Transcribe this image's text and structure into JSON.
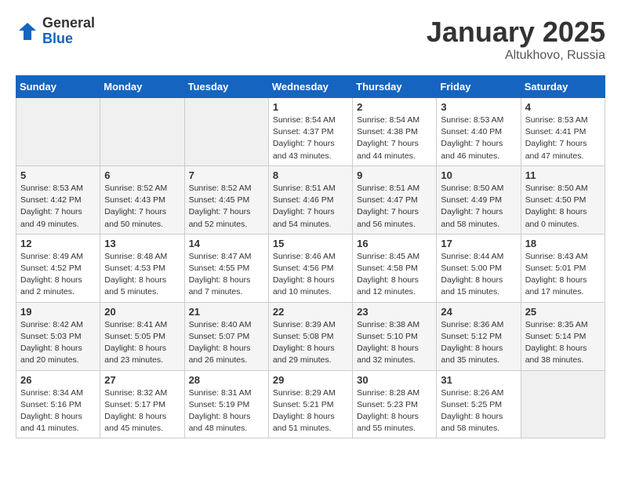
{
  "logo": {
    "general": "General",
    "blue": "Blue"
  },
  "title": "January 2025",
  "location": "Altukhovo, Russia",
  "days_header": [
    "Sunday",
    "Monday",
    "Tuesday",
    "Wednesday",
    "Thursday",
    "Friday",
    "Saturday"
  ],
  "weeks": [
    [
      {
        "day": "",
        "sunrise": "",
        "sunset": "",
        "daylight": ""
      },
      {
        "day": "",
        "sunrise": "",
        "sunset": "",
        "daylight": ""
      },
      {
        "day": "",
        "sunrise": "",
        "sunset": "",
        "daylight": ""
      },
      {
        "day": "1",
        "sunrise": "Sunrise: 8:54 AM",
        "sunset": "Sunset: 4:37 PM",
        "daylight": "Daylight: 7 hours and 43 minutes."
      },
      {
        "day": "2",
        "sunrise": "Sunrise: 8:54 AM",
        "sunset": "Sunset: 4:38 PM",
        "daylight": "Daylight: 7 hours and 44 minutes."
      },
      {
        "day": "3",
        "sunrise": "Sunrise: 8:53 AM",
        "sunset": "Sunset: 4:40 PM",
        "daylight": "Daylight: 7 hours and 46 minutes."
      },
      {
        "day": "4",
        "sunrise": "Sunrise: 8:53 AM",
        "sunset": "Sunset: 4:41 PM",
        "daylight": "Daylight: 7 hours and 47 minutes."
      }
    ],
    [
      {
        "day": "5",
        "sunrise": "Sunrise: 8:53 AM",
        "sunset": "Sunset: 4:42 PM",
        "daylight": "Daylight: 7 hours and 49 minutes."
      },
      {
        "day": "6",
        "sunrise": "Sunrise: 8:52 AM",
        "sunset": "Sunset: 4:43 PM",
        "daylight": "Daylight: 7 hours and 50 minutes."
      },
      {
        "day": "7",
        "sunrise": "Sunrise: 8:52 AM",
        "sunset": "Sunset: 4:45 PM",
        "daylight": "Daylight: 7 hours and 52 minutes."
      },
      {
        "day": "8",
        "sunrise": "Sunrise: 8:51 AM",
        "sunset": "Sunset: 4:46 PM",
        "daylight": "Daylight: 7 hours and 54 minutes."
      },
      {
        "day": "9",
        "sunrise": "Sunrise: 8:51 AM",
        "sunset": "Sunset: 4:47 PM",
        "daylight": "Daylight: 7 hours and 56 minutes."
      },
      {
        "day": "10",
        "sunrise": "Sunrise: 8:50 AM",
        "sunset": "Sunset: 4:49 PM",
        "daylight": "Daylight: 7 hours and 58 minutes."
      },
      {
        "day": "11",
        "sunrise": "Sunrise: 8:50 AM",
        "sunset": "Sunset: 4:50 PM",
        "daylight": "Daylight: 8 hours and 0 minutes."
      }
    ],
    [
      {
        "day": "12",
        "sunrise": "Sunrise: 8:49 AM",
        "sunset": "Sunset: 4:52 PM",
        "daylight": "Daylight: 8 hours and 2 minutes."
      },
      {
        "day": "13",
        "sunrise": "Sunrise: 8:48 AM",
        "sunset": "Sunset: 4:53 PM",
        "daylight": "Daylight: 8 hours and 5 minutes."
      },
      {
        "day": "14",
        "sunrise": "Sunrise: 8:47 AM",
        "sunset": "Sunset: 4:55 PM",
        "daylight": "Daylight: 8 hours and 7 minutes."
      },
      {
        "day": "15",
        "sunrise": "Sunrise: 8:46 AM",
        "sunset": "Sunset: 4:56 PM",
        "daylight": "Daylight: 8 hours and 10 minutes."
      },
      {
        "day": "16",
        "sunrise": "Sunrise: 8:45 AM",
        "sunset": "Sunset: 4:58 PM",
        "daylight": "Daylight: 8 hours and 12 minutes."
      },
      {
        "day": "17",
        "sunrise": "Sunrise: 8:44 AM",
        "sunset": "Sunset: 5:00 PM",
        "daylight": "Daylight: 8 hours and 15 minutes."
      },
      {
        "day": "18",
        "sunrise": "Sunrise: 8:43 AM",
        "sunset": "Sunset: 5:01 PM",
        "daylight": "Daylight: 8 hours and 17 minutes."
      }
    ],
    [
      {
        "day": "19",
        "sunrise": "Sunrise: 8:42 AM",
        "sunset": "Sunset: 5:03 PM",
        "daylight": "Daylight: 8 hours and 20 minutes."
      },
      {
        "day": "20",
        "sunrise": "Sunrise: 8:41 AM",
        "sunset": "Sunset: 5:05 PM",
        "daylight": "Daylight: 8 hours and 23 minutes."
      },
      {
        "day": "21",
        "sunrise": "Sunrise: 8:40 AM",
        "sunset": "Sunset: 5:07 PM",
        "daylight": "Daylight: 8 hours and 26 minutes."
      },
      {
        "day": "22",
        "sunrise": "Sunrise: 8:39 AM",
        "sunset": "Sunset: 5:08 PM",
        "daylight": "Daylight: 8 hours and 29 minutes."
      },
      {
        "day": "23",
        "sunrise": "Sunrise: 8:38 AM",
        "sunset": "Sunset: 5:10 PM",
        "daylight": "Daylight: 8 hours and 32 minutes."
      },
      {
        "day": "24",
        "sunrise": "Sunrise: 8:36 AM",
        "sunset": "Sunset: 5:12 PM",
        "daylight": "Daylight: 8 hours and 35 minutes."
      },
      {
        "day": "25",
        "sunrise": "Sunrise: 8:35 AM",
        "sunset": "Sunset: 5:14 PM",
        "daylight": "Daylight: 8 hours and 38 minutes."
      }
    ],
    [
      {
        "day": "26",
        "sunrise": "Sunrise: 8:34 AM",
        "sunset": "Sunset: 5:16 PM",
        "daylight": "Daylight: 8 hours and 41 minutes."
      },
      {
        "day": "27",
        "sunrise": "Sunrise: 8:32 AM",
        "sunset": "Sunset: 5:17 PM",
        "daylight": "Daylight: 8 hours and 45 minutes."
      },
      {
        "day": "28",
        "sunrise": "Sunrise: 8:31 AM",
        "sunset": "Sunset: 5:19 PM",
        "daylight": "Daylight: 8 hours and 48 minutes."
      },
      {
        "day": "29",
        "sunrise": "Sunrise: 8:29 AM",
        "sunset": "Sunset: 5:21 PM",
        "daylight": "Daylight: 8 hours and 51 minutes."
      },
      {
        "day": "30",
        "sunrise": "Sunrise: 8:28 AM",
        "sunset": "Sunset: 5:23 PM",
        "daylight": "Daylight: 8 hours and 55 minutes."
      },
      {
        "day": "31",
        "sunrise": "Sunrise: 8:26 AM",
        "sunset": "Sunset: 5:25 PM",
        "daylight": "Daylight: 8 hours and 58 minutes."
      },
      {
        "day": "",
        "sunrise": "",
        "sunset": "",
        "daylight": ""
      }
    ]
  ]
}
